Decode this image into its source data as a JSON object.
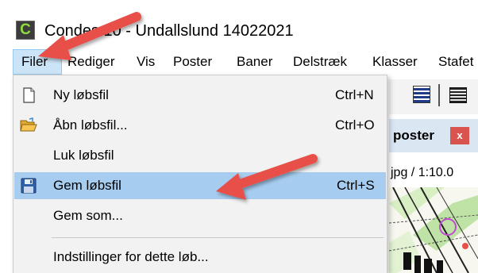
{
  "window": {
    "title": "Condes 10 - Undallslund 14022021",
    "app_icon_letter": "C"
  },
  "menubar": {
    "items": [
      {
        "label": "Filer",
        "active": true
      },
      {
        "label": "Rediger"
      },
      {
        "label": "Vis"
      },
      {
        "label": "Poster"
      },
      {
        "label": "Baner"
      },
      {
        "label": "Delstræk"
      },
      {
        "label": "Klasser"
      },
      {
        "label": "Stafet"
      }
    ]
  },
  "file_menu": {
    "items": [
      {
        "label": "Ny løbsfil",
        "shortcut": "Ctrl+N",
        "icon": "new-file-icon"
      },
      {
        "label": "Åbn løbsfil...",
        "shortcut": "Ctrl+O",
        "icon": "open-folder-icon"
      },
      {
        "label": "Luk løbsfil",
        "shortcut": ""
      },
      {
        "label": "Gem løbsfil",
        "shortcut": "Ctrl+S",
        "icon": "save-disk-icon",
        "highlighted": true
      },
      {
        "label": "Gem som...",
        "shortcut": ""
      },
      {
        "label": "Indstillinger for dette løb...",
        "shortcut": ""
      }
    ]
  },
  "background": {
    "panel_title": "poster",
    "panel_close": "x",
    "map_info": "jpg  / 1:10.0"
  },
  "colors": {
    "menu_highlight": "#a6cdf0",
    "menubar_active": "#cce4f7",
    "arrow": "#e8504a",
    "panel_close": "#d9534f"
  }
}
